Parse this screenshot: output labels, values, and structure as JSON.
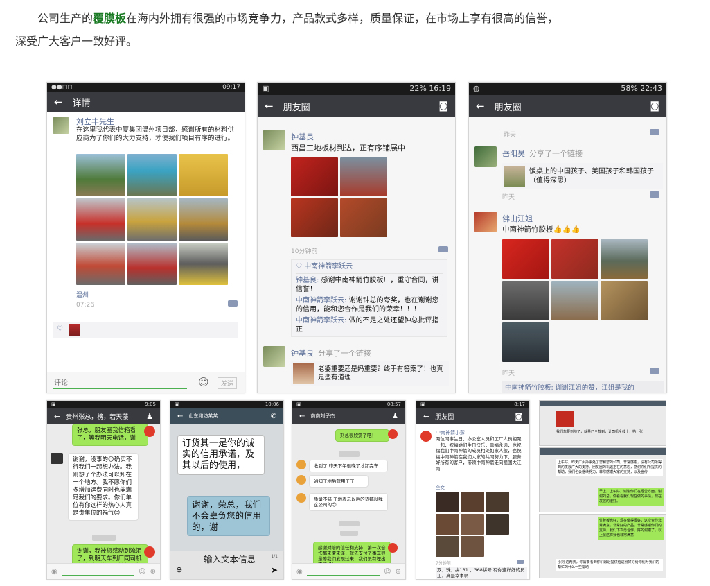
{
  "intro": {
    "prefix": "公司生产的",
    "keyword": "覆膜板",
    "suffix": "在海内外拥有很强的市场竞争力，产品款式多样，质量保证，在市场上享有很高的信誉，",
    "line2": "深受广大客户一致好评。"
  },
  "colors": {
    "keyword": "#1a7a24",
    "wechat_header": "#393a3f",
    "name": "#576b95",
    "bubble": "#a0e75a"
  },
  "p1": {
    "status_right": "09:17",
    "title": "详情",
    "name": "刘立丰先生",
    "text": "在这里我代表中厦集团温州项目部，感谢所有的材料供应商为了你们的大力支持，才使我们项目有序的进行。",
    "location": "温州",
    "time": "07:26",
    "comment_placeholder": "评论",
    "send": "发送"
  },
  "p2": {
    "status_right": "22% 16:19",
    "title": "朋友圈",
    "name": "钟基良",
    "text": "西昌工地板材到达，正有序铺展中",
    "time": "10分钟前",
    "likes": "中南神箭李跃云",
    "comments": [
      {
        "name": "钟基良",
        "text": "感谢中南神箭竹胶板厂，重守合同，讲信誉！"
      },
      {
        "name": "中南神箭李跃云",
        "text": "谢谢钟总的夸奖，也在谢谢您的信用，能和您合作是我们的荣幸！！！"
      },
      {
        "name": "中南神箭李跃云",
        "text": "做的不足之处还望钟总批评指正"
      }
    ],
    "name2": "钟基良",
    "share": "分享了一个链接",
    "link": "老婆重要还是妈重要？终于有答案了！也真是蛮有道理"
  },
  "p3": {
    "status_right": "58% 22:43",
    "title": "朋友圈",
    "time_top": "昨天",
    "name1": "岳阳昊",
    "share": "分享了一个链接",
    "link": "饭桌上的中国孩子、美国孩子和韩国孩子（值得深思）",
    "time1": "昨天",
    "name2": "佛山江姐",
    "text2": "中南神箭竹胶板👍👍👍",
    "time2": "昨天",
    "bottom": "中南神箭竹胶板: 谢谢江姐的赞，江姐是我的"
  },
  "p4": {
    "status_right": "9:05",
    "title": "贵州张总，榜，若天藻",
    "msgs": [
      "张总，朋友圈我信箱看了，等我明天电话，谢",
      "谢谢，没事的😊确实不行我们一起想办法。我刚想了个办法可以卸在一个地方。我不愿你们多增加运费同时也能满足我们的要求。你们单位有你这样的热心人真是贵单位的福气😊",
      "谢谢，我被您感动到流泪了，到明天车到厂同司机商议后再说了，希望司机也能帮我们，谢谢"
    ]
  },
  "p5": {
    "status_right": "10:06",
    "title": "山东潍坊某某",
    "msg1": "订货其一是你的诚实的信用承诺，及其以后的使用，",
    "msg2": "谢谢，荣总，我们不会辜负您的信用的，谢",
    "input": "输入文本信息",
    "counter": "1/1"
  },
  "p6": {
    "status_right": "08:57",
    "title": "南南刘子杰",
    "msgs": [
      "刘总很欣赏了吧！",
      "收到了 昨天下午很晚了才卸完车",
      "通知工地后就用工了",
      "质量不错 工地表示以后的货都以我这公司的😊",
      "感谢对给的信任和支持！第一次合作都来遭来谨，就先支付了事车很量等我们发现过来，我们没有埋出不信好！"
    ]
  },
  "p7": {
    "status_right": "8:17",
    "title": "朋友圈",
    "name": "中南神箭小彭",
    "text": "两位同事生日，办公室人员和工厂人员相聚一起，祝福她们生日快乐，幸福永远，也祝福我们中南神箭的成员相处如家人般，也祝福中南神箭在我们大家的共同努力下，服务好所有的客户，带领中南神箭走向祖国大江南",
    "more": "全文",
    "time": "7分钟前",
    "bottom": "双，珠，拼131   ，368拼号 有你这样好的员工，真是幸事啊"
  },
  "p8": {
    "msg1": "我们车要到地了，就量已全款到，让司机全线上，拍一张",
    "msg2": "上午好，昨天广州办事处了您和您的公司，非常感谢，没有公司所得到的发展广大的支持。朋友圈的机遇正在的意思，感谢你们所提供的帮助，我们也会继续努力，非常感谢大家的支持，以及宣传",
    "msg3": "早上，上午好，谢谢你们在经营方面，谢谢刘总，你看看我们现在做的事情，现在发展的很好。",
    "msg4": "竹胶板也好，现在做得很好，这次合作非常满意，非常好的产品，非常感谢你们的支持，我们下次再合作。好的谢谢了，以上就这样我也非常满意",
    "msg5": "小刘 这两天，你需要看到你们最近提供给这份好好给你们为我们的帮忙的什么一些帮助"
  }
}
